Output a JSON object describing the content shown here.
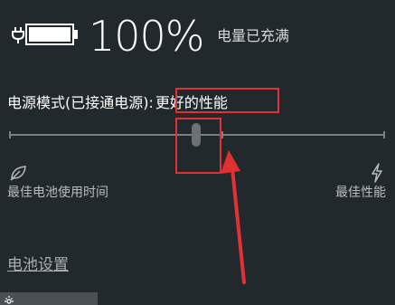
{
  "battery": {
    "percent_text": "100%",
    "level": 1.0,
    "status": "电量已充满",
    "icon": "battery-full-icon",
    "plug_icon": "plug-icon"
  },
  "power_mode": {
    "label": "电源模式(已接通电源):",
    "value": "更好的性能",
    "slider_level": 0.5,
    "left_label": "最佳电池使用时间",
    "right_label": "最佳性能",
    "left_icon": "leaf-icon",
    "right_icon": "lightning-bolt-icon"
  },
  "links": {
    "battery_settings": "电池设置"
  },
  "bottom": {
    "tile_icon": "brightness-icon"
  },
  "annotations": {
    "highlight_color": "#e03232"
  },
  "colors": {
    "background": "#22292c",
    "text": "#ffffff",
    "secondary_text": "#b8bcbe",
    "track": "#7a8083",
    "thumb": "#6b7174",
    "tile": "#4a5053"
  }
}
